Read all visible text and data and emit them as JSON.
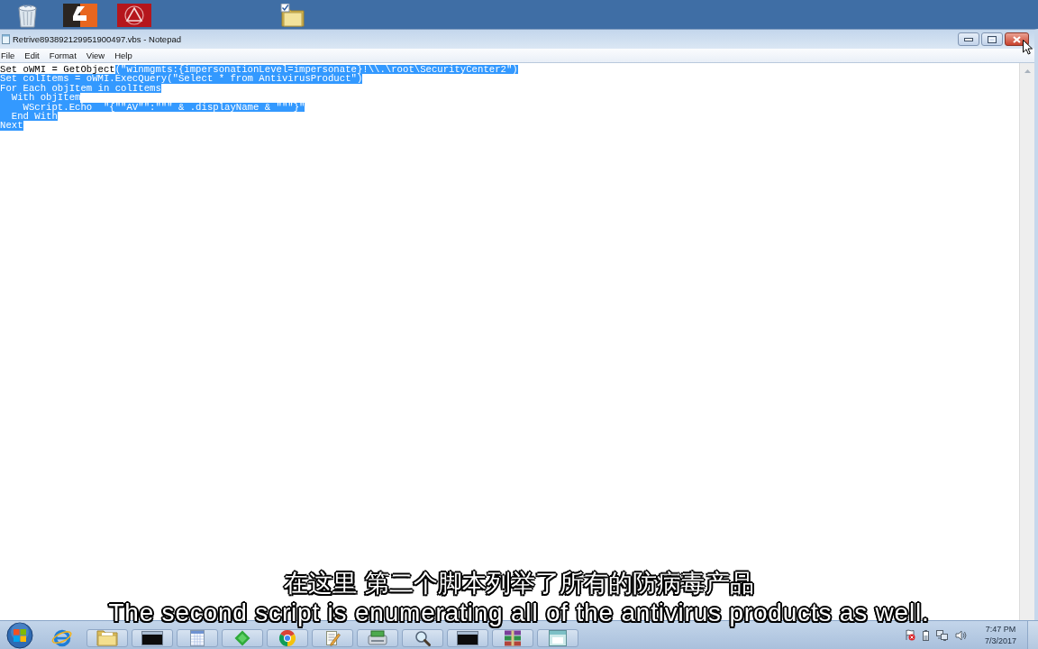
{
  "window": {
    "title": "Retrive893892129951900497.vbs - Notepad"
  },
  "menu": [
    {
      "label": "File"
    },
    {
      "label": "Edit"
    },
    {
      "label": "Format"
    },
    {
      "label": "View"
    },
    {
      "label": "Help"
    }
  ],
  "editor": {
    "lines": [
      {
        "segments": [
          {
            "text": "Set oWMI = GetObject",
            "selected": false
          },
          {
            "text": "(\"winmgmts:{impersonationLevel=impersonate}!\\\\.\\root\\SecurityCenter2\")",
            "selected": true
          }
        ]
      },
      {
        "segments": [
          {
            "text": "Set colItems = oWMI.ExecQuery(\"Select * from AntivirusProduct\")",
            "selected": true
          }
        ]
      },
      {
        "segments": [
          {
            "text": "For Each objItem in colItems",
            "selected": true
          }
        ]
      },
      {
        "segments": [
          {
            "text": "  With objItem",
            "selected": true
          }
        ]
      },
      {
        "segments": [
          {
            "text": "    WScript.Echo  \"{\"\"AV\"\":\"\"\" & .displayName & \"\"\"}\"",
            "selected": true
          }
        ]
      },
      {
        "segments": [
          {
            "text": "  End With",
            "selected": true
          }
        ]
      },
      {
        "segments": [
          {
            "text": "Next",
            "selected": true
          }
        ]
      }
    ]
  },
  "taskbar": {
    "buttons": [
      {
        "kind": "browser",
        "running": false
      },
      {
        "kind": "folder",
        "running": true
      },
      {
        "kind": "terminal",
        "running": true
      },
      {
        "kind": "notepad",
        "running": true
      },
      {
        "kind": "shield",
        "running": true
      },
      {
        "kind": "circle-logo",
        "running": true
      },
      {
        "kind": "document-pen",
        "running": true
      },
      {
        "kind": "device",
        "running": true
      },
      {
        "kind": "magnifier",
        "running": true
      },
      {
        "kind": "terminal",
        "running": true
      },
      {
        "kind": "archive",
        "running": true
      },
      {
        "kind": "app-window",
        "running": true
      }
    ],
    "clock": {
      "time": "7:47 PM",
      "date": "7/3/2017"
    }
  },
  "subtitles": {
    "chinese": "在这里 第二个脚本列举了所有的防病毒产品",
    "english": "The second script is enumerating all of the antivirus products as well."
  }
}
